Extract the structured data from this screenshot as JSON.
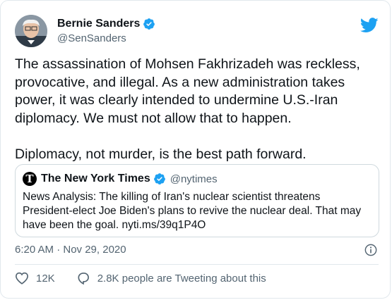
{
  "author": {
    "name": "Bernie Sanders",
    "handle": "@SenSanders",
    "avatar_icon": "avatar-photo",
    "verified": true
  },
  "tweet": {
    "text": "The assassination of Mohsen Fakhrizadeh was reckless, provocative, and illegal. As a new administration takes power, it was clearly intended to undermine U.S.-Iran diplomacy. We must not allow that to happen.\n\nDiplomacy, not murder, is the best path forward."
  },
  "quote": {
    "logo_letter": "T",
    "name": "The New York Times",
    "handle": "@nytimes",
    "text": "News Analysis: The killing of Iran's nuclear scientist threatens President-elect Joe Biden's plans to revive the nuclear deal. That may have been the goal. nyti.ms/39q1P4O"
  },
  "meta": {
    "timestamp": "6:20 AM · Nov 29, 2020"
  },
  "actions": {
    "likes": "12K",
    "tweeting": "2.8K people are Tweeting about this"
  },
  "colors": {
    "twitter_blue": "#1da1f2",
    "secondary_text": "#536471",
    "verified": "#1da1f2"
  }
}
